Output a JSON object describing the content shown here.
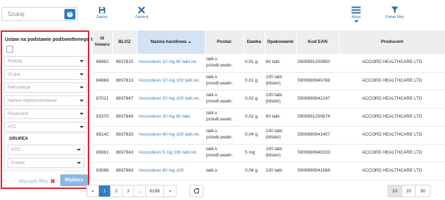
{
  "search": {
    "placeholder": "Szukaj",
    "help_icon": "question-circle-icon"
  },
  "toolbar": {
    "save_label": "Zapisz",
    "close_label": "Zamknij",
    "actions_label": "Akcje",
    "show_filters_label": "Pokaż filtry",
    "icons": {
      "save": "floppy-disk-icon",
      "close": "x-icon",
      "actions": "hamburger-menu-icon",
      "filters": "funnel-icon"
    }
  },
  "filters": {
    "title": "Ustaw na podstawie podświetlonego towaru",
    "checked": false,
    "selects": [
      "Rodzaj",
      "Grupa",
      "Refundacja",
      "Nazwa międzynarodowa",
      "Producent",
      "ATC"
    ],
    "grupex": {
      "title": "GRUPEX",
      "selects": [
        "GTC",
        "Postać"
      ]
    },
    "clear_label": "Wyczyść filtry",
    "choose_label": "Wybierz",
    "border_color": "#e41e26"
  },
  "table": {
    "headers": {
      "id": [
        "Id",
        "towaru"
      ],
      "bloz": "BLOZ",
      "name": "Nazwa handlowa",
      "form": "Postać",
      "dose": "Dawka",
      "pack": "Opakowanie",
      "ean": "Kod EAN",
      "producer": "Producent"
    },
    "sort_indicator": "▲",
    "rows": [
      {
        "id": "86962",
        "bloz": "8937815",
        "name": "!Accordeon 10 mg 60 tabl.ret.",
        "form": "tabl.o przedł.uwaln.",
        "dose": "0,01 g",
        "pack": "60 tabl.",
        "ean": "5909991250850",
        "producer": "ACCORD HEALTHCARE LTD"
      },
      {
        "id": "84866",
        "bloz": "8937813",
        "name": "!Accordeon 10 mg 100 tabl.ret.",
        "form": "tabl.o przedł.uwaln.",
        "dose": "0,01 g",
        "pack": "100 tabl. (blister)",
        "ean": "5909990940769",
        "producer": "ACCORD HEALTHCARE LTD"
      },
      {
        "id": "87021",
        "bloz": "8937847",
        "name": "!Accordeon 20 mg 100 tabl.ret.",
        "form": "tabl.o przedł.uwaln.",
        "dose": "0,02 g",
        "pack": "100 tabl. (blister)",
        "ean": "5909990941247",
        "producer": "ACCORD HEALTHCARE LTD"
      },
      {
        "id": "93370",
        "bloz": "8937849",
        "name": "!Accordeon 20 mg 60 tabl.",
        "form": "tabl.o przedł.uwaln.",
        "dose": "0,02 g",
        "pack": "60 tabl.",
        "ean": "5909991250874",
        "producer": "ACCORD HEALTHCARE LTD"
      },
      {
        "id": "85142",
        "bloz": "8937833",
        "name": "!Accordeon 40 mg 100 tabl.ret.",
        "form": "tabl.o przedł.uwaln.",
        "dose": "0,04 g",
        "pack": "100 tabl. (blister)",
        "ean": "5909990941407",
        "producer": "ACCORD HEALTHCARE LTD"
      },
      {
        "id": "85661",
        "bloz": "8937943",
        "name": "!Accordeon 5 mg 100 tabl.ret.",
        "form": "tabl.o przedł.uwaln.",
        "dose": "5 mg",
        "pack": "100 tabl. (blister)",
        "ean": "5909990940233",
        "producer": "ACCORD HEALTHCARE LTD"
      },
      {
        "id": "83086",
        "bloz": "8937863",
        "name": "!Accordeon 80 mg 100",
        "form": "tabl.o",
        "dose": "0,08 g",
        "pack": "100 tabl.",
        "ean": "5909990941568",
        "producer": "ACCORD HEALTHCARE LTD"
      }
    ]
  },
  "pagination": {
    "prev": "«",
    "pages": [
      "1",
      "2",
      "3",
      "...",
      "6199"
    ],
    "next": "»",
    "active_page": "1",
    "refresh_icon": "refresh-icon",
    "page_sizes": [
      "10",
      "20",
      "50"
    ],
    "active_page_size": "10",
    "accent_color": "#2f7ec1"
  }
}
